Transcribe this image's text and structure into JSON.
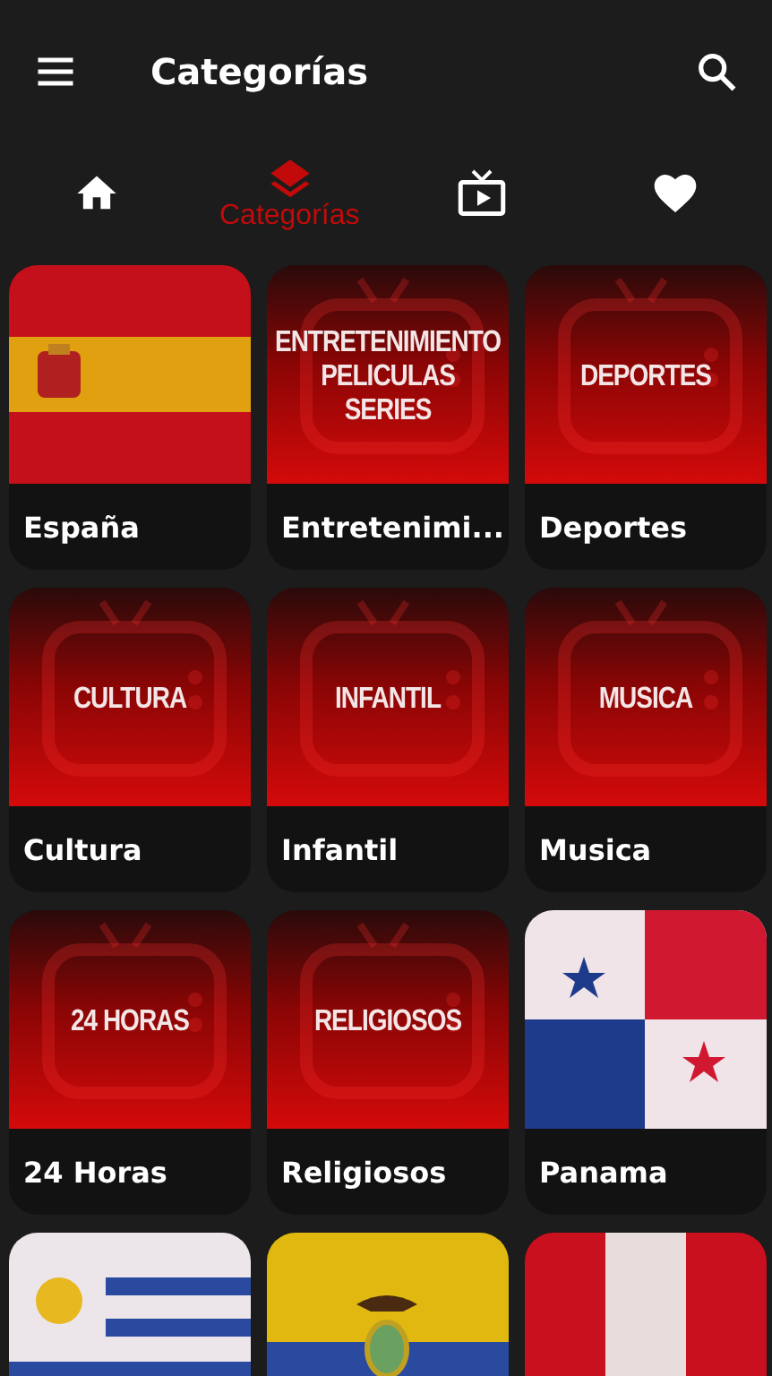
{
  "app_bar": {
    "title": "Categorías"
  },
  "tabs": [
    {
      "kind": "home",
      "selected": false
    },
    {
      "kind": "layers",
      "selected": true,
      "label": "Categorías"
    },
    {
      "kind": "tv",
      "selected": false
    },
    {
      "kind": "heart",
      "selected": false
    }
  ],
  "cards": [
    {
      "kind": "spain",
      "label": "España"
    },
    {
      "kind": "category",
      "banner": [
        "ENTRETENIMIENTO",
        "PELICULAS",
        "SERIES"
      ],
      "label": "Entretenimi..."
    },
    {
      "kind": "category",
      "banner": [
        "DEPORTES"
      ],
      "label": "Deportes"
    },
    {
      "kind": "category",
      "banner": [
        "CULTURA"
      ],
      "label": "Cultura"
    },
    {
      "kind": "category",
      "banner": [
        "INFANTIL"
      ],
      "label": "Infantil"
    },
    {
      "kind": "category",
      "banner": [
        "MUSICA"
      ],
      "label": "Musica"
    },
    {
      "kind": "category",
      "banner": [
        "24 HORAS"
      ],
      "label": "24 Horas"
    },
    {
      "kind": "category",
      "banner": [
        "RELIGIOSOS"
      ],
      "label": "Religiosos"
    },
    {
      "kind": "panama",
      "label": "Panama"
    },
    {
      "kind": "uruguay"
    },
    {
      "kind": "ecuador"
    },
    {
      "kind": "peru"
    }
  ]
}
